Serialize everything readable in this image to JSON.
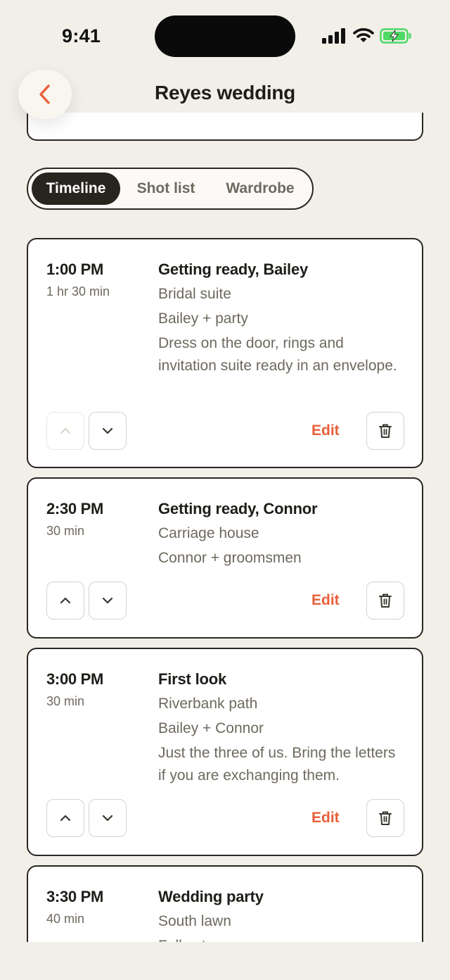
{
  "status_bar": {
    "time": "9:41",
    "icons": [
      "signal-icon",
      "wifi-icon",
      "battery-charging-icon"
    ]
  },
  "header": {
    "title": "Reyes wedding",
    "back_icon": "chevron-left-icon"
  },
  "tabs": [
    {
      "label": "Timeline",
      "active": true
    },
    {
      "label": "Shot list",
      "active": false
    },
    {
      "label": "Wardrobe",
      "active": false
    }
  ],
  "events": [
    {
      "time": "1:00 PM",
      "duration": "1 hr 30 min",
      "title": "Getting ready, Bailey",
      "location": "Bridal suite",
      "people": "Bailey + party",
      "notes": "Dress on the door, rings and invitation suite ready in an envelope.",
      "edit_label": "Edit",
      "move_up_enabled": false,
      "move_down_enabled": true
    },
    {
      "time": "2:30 PM",
      "duration": "30 min",
      "title": "Getting ready, Connor",
      "location": "Carriage house",
      "people": "Connor + groomsmen",
      "notes": "",
      "edit_label": "Edit",
      "move_up_enabled": true,
      "move_down_enabled": true
    },
    {
      "time": "3:00 PM",
      "duration": "30 min",
      "title": "First look",
      "location": "Riverbank path",
      "people": "Bailey + Connor",
      "notes": "Just the three of us. Bring the letters if you are exchanging them.",
      "edit_label": "Edit",
      "move_up_enabled": true,
      "move_down_enabled": true
    },
    {
      "time": "3:30 PM",
      "duration": "40 min",
      "title": "Wedding party",
      "location": "South lawn",
      "people": "Full set"
    }
  ],
  "colors": {
    "accent": "#e8603a",
    "ink": "#28251f",
    "muted": "#6e695f",
    "background": "#f1efe8",
    "battery": "#4cd964"
  }
}
